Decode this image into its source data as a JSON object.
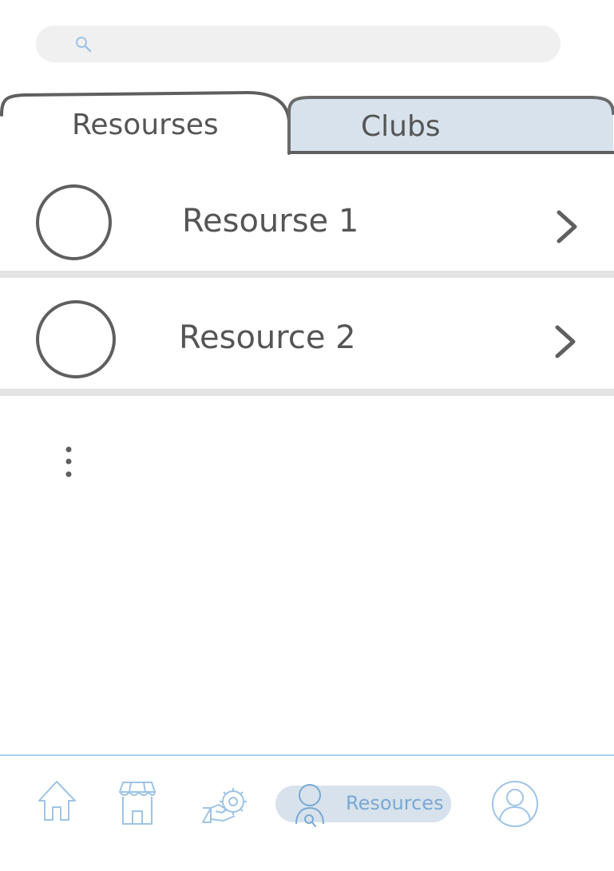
{
  "search": {
    "placeholder": "",
    "value": ""
  },
  "tabs": [
    {
      "label": "Resourses",
      "active": true
    },
    {
      "label": "Clubs",
      "active": false
    }
  ],
  "list": {
    "items": [
      {
        "label": "Resourse 1"
      },
      {
        "label": "Resource 2"
      }
    ],
    "more_indicator": "more-vertical-dots"
  },
  "bottom_nav": {
    "items": [
      {
        "icon": "home-icon",
        "label": ""
      },
      {
        "icon": "store-icon",
        "label": ""
      },
      {
        "icon": "handshake-gear-icon",
        "label": ""
      },
      {
        "icon": "person-search-icon",
        "label": "Resources",
        "active": true
      },
      {
        "icon": "profile-icon",
        "label": ""
      }
    ]
  },
  "colors": {
    "ink": "#5f5f5f",
    "inactive_tab_fill": "#d7e2ec",
    "divider": "#e3e3e3",
    "search_fill": "#f0f0f0",
    "accent": "#7aa8d2",
    "nav_line": "#a9cdea"
  }
}
